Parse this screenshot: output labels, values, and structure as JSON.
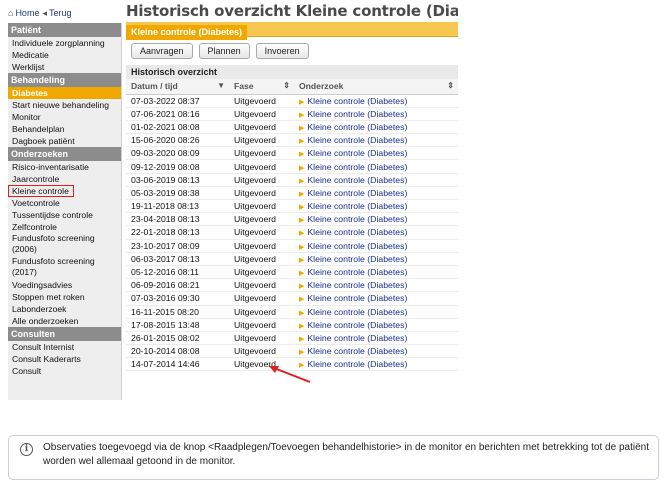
{
  "topnav": {
    "home_label": "Home",
    "back_label": "Terug"
  },
  "page_title": "Historisch overzicht Kleine controle (Diabetes)",
  "sidebar": {
    "sections": [
      {
        "title": "Patiënt",
        "items": [
          {
            "label": "Individuele zorgplanning"
          },
          {
            "label": "Medicatie"
          },
          {
            "label": "Werklijst"
          }
        ]
      },
      {
        "title": "Behandeling",
        "items": [
          {
            "label": "Diabetes",
            "active": true
          },
          {
            "label": "Start nieuwe behandeling"
          },
          {
            "label": "Monitor"
          },
          {
            "label": "Behandelplan"
          },
          {
            "label": "Dagboek patiënt"
          }
        ]
      },
      {
        "title": "Onderzoeken",
        "items": [
          {
            "label": "Risico-inventarisatie"
          },
          {
            "label": "Jaarcontrole"
          },
          {
            "label": "Kleine controle",
            "highlighted": true
          },
          {
            "label": "Voetcontrole"
          },
          {
            "label": "Tussentijdse controle"
          },
          {
            "label": "Zelfcontrole"
          },
          {
            "label": "Fundusfoto screening (2006)"
          },
          {
            "label": "Fundusfoto screening (2017)"
          },
          {
            "label": "Voedingsadvies"
          },
          {
            "label": "Stoppen met roken"
          },
          {
            "label": "Labonderzoek"
          },
          {
            "label": "Alle onderzoeken"
          }
        ]
      },
      {
        "title": "Consulten",
        "items": [
          {
            "label": "Consult Internist"
          },
          {
            "label": "Consult Kaderarts"
          },
          {
            "label": "Consult"
          }
        ]
      }
    ]
  },
  "tab_label": "Kleine controle (Diabetes)",
  "buttons": {
    "aanvragen": "Aanvragen",
    "plannen": "Plannen",
    "invoeren": "Invoeren"
  },
  "history_header": "Historisch overzicht",
  "table": {
    "columns": [
      "Datum / tijd",
      "Fase",
      "Onderzoek"
    ],
    "rows": [
      [
        "07-03-2022 08:37",
        "Uitgevoerd",
        "Kleine controle (Diabetes)"
      ],
      [
        "07-06-2021 08:16",
        "Uitgevoerd",
        "Kleine controle (Diabetes)"
      ],
      [
        "01-02-2021 08:08",
        "Uitgevoerd",
        "Kleine controle (Diabetes)"
      ],
      [
        "15-06-2020 08:26",
        "Uitgevoerd",
        "Kleine controle (Diabetes)"
      ],
      [
        "09-03-2020 08:09",
        "Uitgevoerd",
        "Kleine controle (Diabetes)"
      ],
      [
        "09-12-2019 08:08",
        "Uitgevoerd",
        "Kleine controle (Diabetes)"
      ],
      [
        "03-06-2019 08:13",
        "Uitgevoerd",
        "Kleine controle (Diabetes)"
      ],
      [
        "05-03-2019 08:38",
        "Uitgevoerd",
        "Kleine controle (Diabetes)"
      ],
      [
        "19-11-2018 08:13",
        "Uitgevoerd",
        "Kleine controle (Diabetes)"
      ],
      [
        "23-04-2018 08:13",
        "Uitgevoerd",
        "Kleine controle (Diabetes)"
      ],
      [
        "22-01-2018 08:13",
        "Uitgevoerd",
        "Kleine controle (Diabetes)"
      ],
      [
        "23-10-2017 08:09",
        "Uitgevoerd",
        "Kleine controle (Diabetes)"
      ],
      [
        "06-03-2017 08:13",
        "Uitgevoerd",
        "Kleine controle (Diabetes)"
      ],
      [
        "05-12-2016 08:11",
        "Uitgevoerd",
        "Kleine controle (Diabetes)"
      ],
      [
        "06-09-2016 08:21",
        "Uitgevoerd",
        "Kleine controle (Diabetes)"
      ],
      [
        "07-03-2016 09:30",
        "Uitgevoerd",
        "Kleine controle (Diabetes)"
      ],
      [
        "16-11-2015 08:20",
        "Uitgevoerd",
        "Kleine controle (Diabetes)"
      ],
      [
        "17-08-2015 13:48",
        "Uitgevoerd",
        "Kleine controle (Diabetes)"
      ],
      [
        "26-01-2015 08:02",
        "Uitgevoerd",
        "Kleine controle (Diabetes)"
      ],
      [
        "20-10-2014 08:08",
        "Uitgevoerd",
        "Kleine controle (Diabetes)"
      ],
      [
        "14-07-2014 14:46",
        "Uitgevoerd",
        "Kleine controle (Diabetes)"
      ]
    ]
  },
  "info_text": "Observaties toegevoegd via de knop <Raadplegen/Toevoegen behandelhistorie> in de monitor en berichten met betrekking tot de patiënt worden wel allemaal getoond in de monitor.",
  "colors": {
    "accent": "#f0a800",
    "section": "#8c8c8c",
    "link": "#1a2f8f",
    "annotation": "#e02020"
  }
}
